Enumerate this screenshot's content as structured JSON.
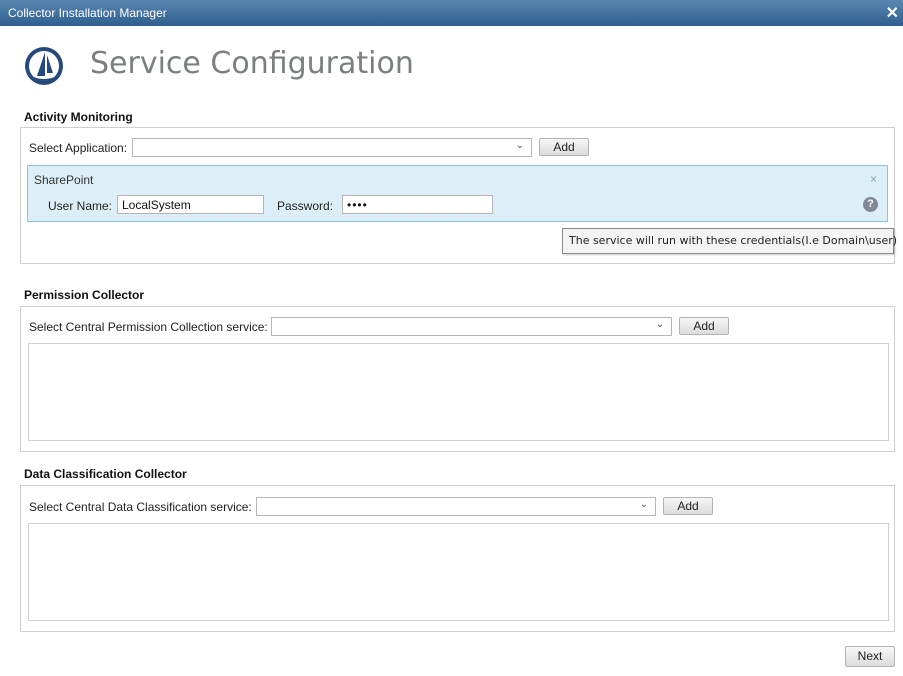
{
  "window": {
    "title": "Collector Installation Manager",
    "close_glyph": "✕"
  },
  "header": {
    "title": "Service Configuration",
    "logo_icon": "sailboat-logo-icon"
  },
  "activity_monitoring": {
    "title": "Activity Monitoring",
    "select_label": "Select Application:",
    "select_value": "",
    "add_label": "Add",
    "entry": {
      "name": "SharePoint",
      "close_glyph": "×",
      "username_label": "User Name:",
      "username_value": "LocalSystem",
      "password_label": "Password:",
      "password_value": "••••",
      "help_glyph": "?"
    },
    "tooltip": "The service will run with these credentials(I.e Domain\\user)"
  },
  "permission_collector": {
    "title": "Permission Collector",
    "select_label": "Select Central Permission Collection service:",
    "select_value": "",
    "add_label": "Add"
  },
  "data_classification": {
    "title": "Data Classification Collector",
    "select_label": "Select Central Data Classification service:",
    "select_value": "",
    "add_label": "Add"
  },
  "footer": {
    "next_label": "Next"
  },
  "colors": {
    "titlebar": "#3a6a99",
    "panel_bg": "#dceff8",
    "panel_border": "#8cc4e0",
    "logo": "#25497a"
  }
}
